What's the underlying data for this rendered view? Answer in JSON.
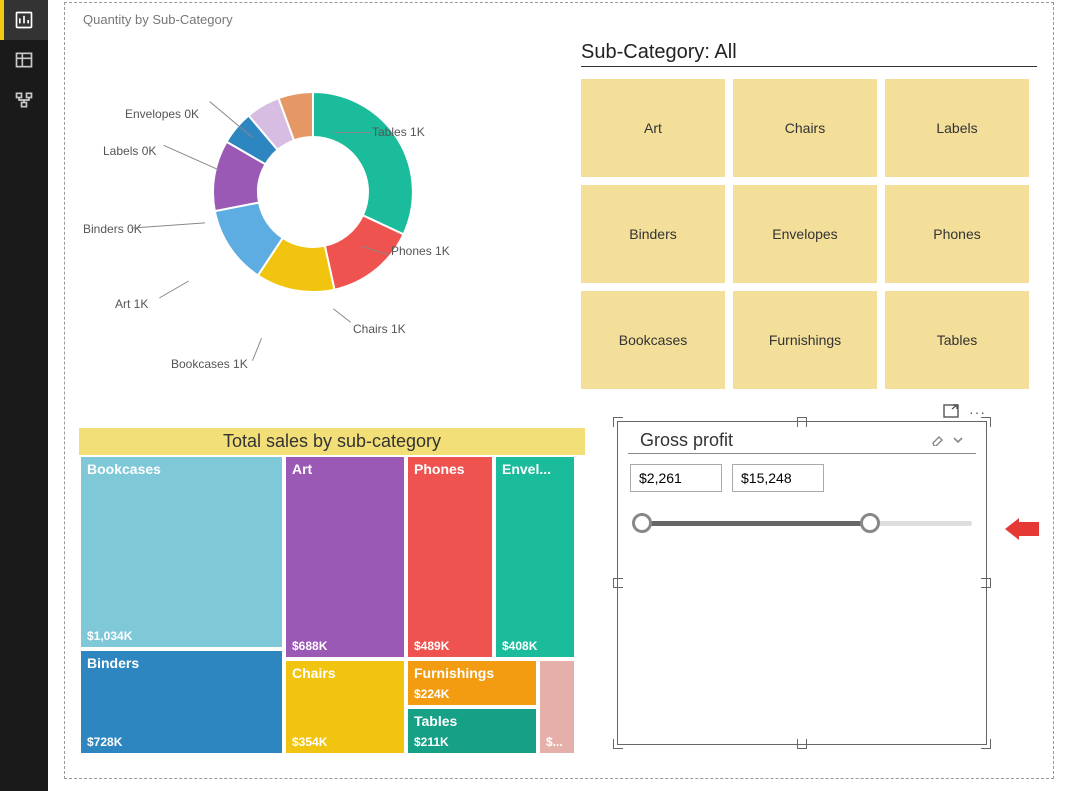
{
  "sidebar": {
    "items": [
      {
        "name": "report",
        "active": true
      },
      {
        "name": "data",
        "active": false
      },
      {
        "name": "model",
        "active": false
      }
    ]
  },
  "donut": {
    "title": "Quantity by Sub-Category",
    "labels": {
      "tables": "Tables 1K",
      "phones": "Phones 1K",
      "chairs": "Chairs 1K",
      "bookcases": "Bookcases 1K",
      "art": "Art 1K",
      "binders": "Binders 0K",
      "labels": "Labels 0K",
      "envelopes": "Envelopes 0K"
    }
  },
  "slicer_tiles": {
    "title": "Sub-Category: All",
    "items": [
      "Art",
      "Chairs",
      "Labels",
      "Binders",
      "Envelopes",
      "Phones",
      "Bookcases",
      "Furnishings",
      "Tables"
    ]
  },
  "treemap": {
    "title": "Total sales by sub-category",
    "boxes": {
      "bookcases": {
        "label": "Bookcases",
        "value": "$1,034K"
      },
      "binders": {
        "label": "Binders",
        "value": "$728K"
      },
      "art": {
        "label": "Art",
        "value": "$688K"
      },
      "chairs": {
        "label": "Chairs",
        "value": "$354K"
      },
      "phones": {
        "label": "Phones",
        "value": "$489K"
      },
      "furnishings": {
        "label": "Furnishings",
        "value": "$224K"
      },
      "tables": {
        "label": "Tables",
        "value": "$211K"
      },
      "envelopes": {
        "label": "Envel...",
        "value": "$408K"
      },
      "labels": {
        "label": "",
        "value": "$..."
      }
    }
  },
  "range": {
    "title": "Gross profit",
    "min": "$2,261",
    "max": "$15,248"
  },
  "chart_data": [
    {
      "type": "pie",
      "title": "Quantity by Sub-Category",
      "series": [
        {
          "name": "Quantity",
          "categories": [
            "Tables",
            "Phones",
            "Chairs",
            "Bookcases",
            "Art",
            "Binders",
            "Labels",
            "Envelopes"
          ],
          "values_label": [
            "1K",
            "1K",
            "1K",
            "1K",
            "1K",
            "0K",
            "0K",
            "0K"
          ],
          "values": [
            1000,
            1000,
            1000,
            1000,
            1000,
            400,
            300,
            300
          ],
          "colors": [
            "#1abc9c",
            "#ef5350",
            "#f1c40f",
            "#5dade2",
            "#9b59b6",
            "#2e86c1",
            "#d7bde2",
            "#e59866"
          ]
        }
      ],
      "donut": true
    },
    {
      "type": "table",
      "title": "Sub-Category slicer tiles",
      "categories": [
        "Art",
        "Chairs",
        "Labels",
        "Binders",
        "Envelopes",
        "Phones",
        "Bookcases",
        "Furnishings",
        "Tables"
      ]
    },
    {
      "type": "bar",
      "title": "Total sales by sub-category",
      "orientation": "treemap",
      "categories": [
        "Bookcases",
        "Binders",
        "Art",
        "Phones",
        "Envelopes",
        "Chairs",
        "Furnishings",
        "Tables",
        "Labels"
      ],
      "values": [
        1034,
        728,
        688,
        489,
        408,
        354,
        224,
        211,
        60
      ],
      "unit": "$K",
      "colors": [
        "#7ec8d8",
        "#2e86c1",
        "#9b59b6",
        "#ef5350",
        "#1abc9c",
        "#f1c40f",
        "#f39c12",
        "#16a085",
        "#e6b0aa"
      ]
    },
    {
      "type": "table",
      "title": "Gross profit range slicer",
      "columns": [
        "min",
        "max"
      ],
      "rows": [
        [
          "$2,261",
          "$15,248"
        ]
      ]
    }
  ]
}
